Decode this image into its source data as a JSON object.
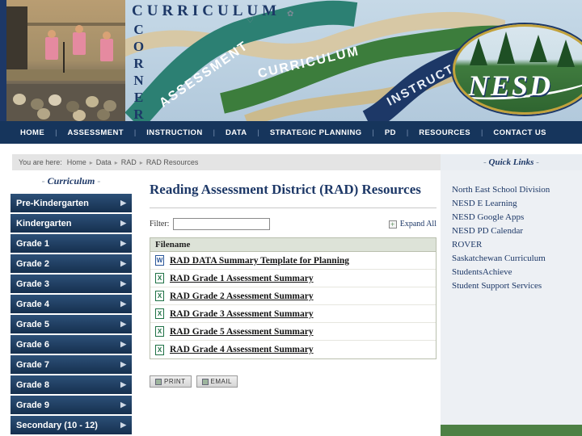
{
  "banner": {
    "title_top": "CURRICULUM",
    "title_side": "CORNER",
    "ribbons": [
      "ASSESSMENT",
      "CURRICULUM",
      "INSTRUCTION"
    ],
    "logo_text": "NESD"
  },
  "nav": {
    "items": [
      "HOME",
      "ASSESSMENT",
      "INSTRUCTION",
      "DATA",
      "STRATEGIC PLANNING",
      "PD",
      "RESOURCES",
      "CONTACT US"
    ]
  },
  "breadcrumb": {
    "prefix": "You are here:",
    "items": [
      "Home",
      "Data",
      "RAD",
      "RAD Resources"
    ]
  },
  "sidebar": {
    "heading": "Curriculum",
    "items": [
      "Pre-Kindergarten",
      "Kindergarten",
      "Grade 1",
      "Grade 2",
      "Grade 3",
      "Grade 4",
      "Grade 5",
      "Grade 6",
      "Grade 7",
      "Grade 8",
      "Grade 9",
      "Secondary (10 - 12)"
    ]
  },
  "main": {
    "title": "Reading Assessment District (RAD) Resources",
    "filter_label": "Filter:",
    "filter_value": "",
    "expand_all_label": "Expand All",
    "table": {
      "columns": [
        "Filename"
      ],
      "rows": [
        {
          "name": "RAD DATA Summary Template for Planning",
          "icon": "word-icon"
        },
        {
          "name": "RAD Grade 1 Assessment Summary",
          "icon": "excel-icon"
        },
        {
          "name": "RAD Grade 2 Assessment Summary",
          "icon": "excel-icon"
        },
        {
          "name": "RAD Grade 3 Assessment Summary",
          "icon": "excel-icon"
        },
        {
          "name": "RAD Grade 5 Assessment Summary",
          "icon": "excel-icon"
        },
        {
          "name": "RAD Grade 4 Assessment Summary",
          "icon": "excel-icon"
        }
      ]
    },
    "buttons": [
      "Print",
      "Email"
    ]
  },
  "quick_links": {
    "heading": "Quick Links",
    "items": [
      "North East School Division",
      "NESD E Learning",
      "NESD Google Apps",
      "NESD PD Calendar",
      "ROVER",
      "Saskatchewan Curriculum",
      "StudentsAchieve",
      "Student Support Services"
    ]
  }
}
